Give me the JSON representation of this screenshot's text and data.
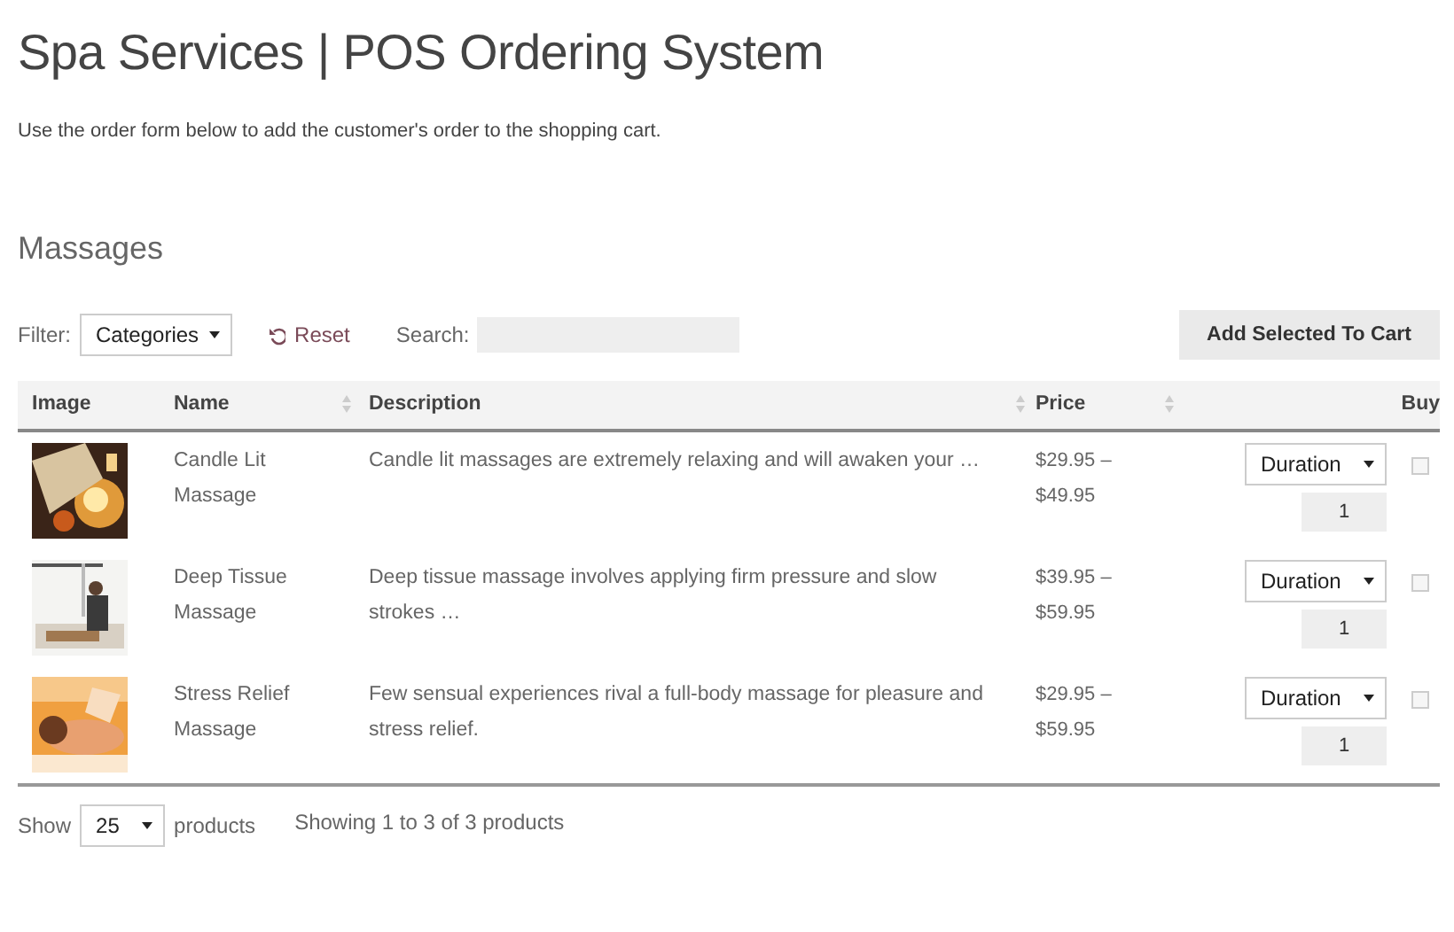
{
  "page": {
    "title": "Spa Services | POS Ordering System",
    "intro": "Use the order form below to add the customer's order to the shopping cart."
  },
  "section": {
    "title": "Massages"
  },
  "toolbar": {
    "filter_label": "Filter:",
    "filter_value": "Categories",
    "reset": "Reset",
    "search_label": "Search:",
    "add_button": "Add Selected To Cart"
  },
  "table": {
    "columns": [
      {
        "label": "Image",
        "sortable": false
      },
      {
        "label": "Name",
        "sortable": true
      },
      {
        "label": "Description",
        "sortable": true
      },
      {
        "label": "Price",
        "sortable": true
      },
      {
        "label": "Buy",
        "sortable": false
      }
    ],
    "rows": [
      {
        "name": "Candle Lit Massage",
        "description": "Candle lit massages are extremely relaxing and will awaken your …",
        "price": "$29.95 – $49.95",
        "option": "Duration",
        "quantity": "1",
        "checked": false
      },
      {
        "name": "Deep Tissue Massage",
        "description": "Deep tissue massage involves applying firm pressure and slow strokes …",
        "price": "$39.95 – $59.95",
        "option": "Duration",
        "quantity": "1",
        "checked": false
      },
      {
        "name": "Stress Relief Massage",
        "description": "Few sensual experiences rival a full-body massage for pleasure and stress relief.",
        "price": "$29.95 – $59.95",
        "option": "Duration",
        "quantity": "1",
        "checked": false
      }
    ]
  },
  "footer": {
    "show_label": "Show",
    "page_size": "25",
    "products_label": "products",
    "summary": "Showing 1 to 3 of 3 products"
  }
}
